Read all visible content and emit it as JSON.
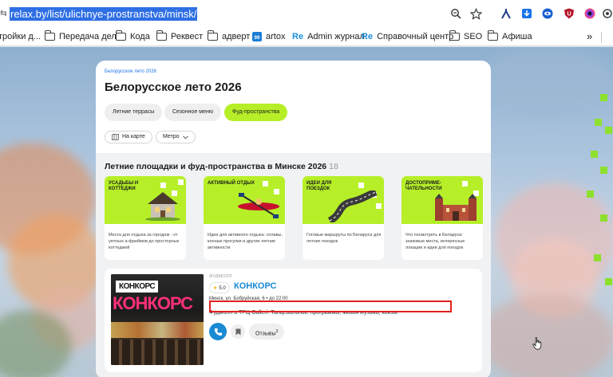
{
  "browser": {
    "url": "relax.by/list/ulichnye-prostranstva/minsk/",
    "bookmarks": [
      {
        "label": "тройки д..."
      },
      {
        "label": "Передача дел"
      },
      {
        "label": "Кода"
      },
      {
        "label": "Реквест"
      },
      {
        "label": "адверт"
      },
      {
        "label": "artox"
      },
      {
        "label": "Admin журнал"
      },
      {
        "label": "Справочный центр"
      },
      {
        "label": "SEO"
      },
      {
        "label": "Афиша"
      }
    ],
    "more_label": "»"
  },
  "page": {
    "breadcrumb": "Белорусское лето 2026",
    "title": "Белорусское лето 2026",
    "chips": [
      {
        "label": "Летние террасы"
      },
      {
        "label": "Сезонное меню"
      },
      {
        "label": "Фуд-пространства"
      }
    ],
    "filters": {
      "map_label": "На карте",
      "metro_label": "Метро"
    },
    "section_title": "Летние площадки и фуд-пространства в Минске 2026",
    "section_count": "18",
    "tiles": [
      {
        "title": "Усадьбы и коттеджи",
        "desc": "Места для отдыха за городом - от уютных а-фреймов до просторных коттеджей"
      },
      {
        "title": "Активный отдых",
        "desc": "Идеи для активного отдыха: сплавы, конные прогулки и другие летние активности"
      },
      {
        "title": "Идеи для поездок",
        "desc": "Готовые маршруты по Беларуси для летних поездок"
      },
      {
        "title": "Достоприме-чательности",
        "desc": "Что посмотреть в Беларуси: знаковые места, интересные локации и идеи для поездок"
      }
    ],
    "result": {
      "tag": "ФУДМОЛЛ",
      "rating": "5.0",
      "name": "КОНКОРС",
      "thumb_brand": "КОНКОРС",
      "thumb_overlay": "КОНКОРС",
      "address": "Минск, ул. Бобруйская, 6 • до 22:00",
      "description": "Фудмолл в ТРЦ Galleri. Танцевальные программы, живая музыка, квизы.",
      "reviews_label": "Отзывы",
      "reviews_count": "3"
    }
  },
  "colors": {
    "accent_green": "#b6ef28",
    "link_blue": "#1a8ad4",
    "highlight_red": "#e02020"
  }
}
